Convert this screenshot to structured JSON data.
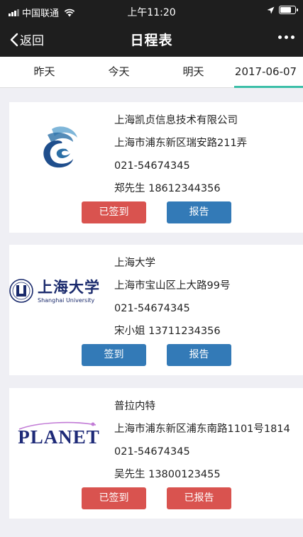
{
  "status_bar": {
    "carrier": "中国联通",
    "time": "上午11:20"
  },
  "nav": {
    "back_label": "返回",
    "title": "日程表"
  },
  "tabs": [
    {
      "label": "昨天",
      "active": false
    },
    {
      "label": "今天",
      "active": false
    },
    {
      "label": "明天",
      "active": false
    },
    {
      "label": "2017-06-07",
      "active": true
    }
  ],
  "accent_color": "#3cbfa8",
  "cards": [
    {
      "logo": "kaizhen-logo",
      "name": "上海凯贞信息技术有限公司",
      "address": "上海市浦东新区瑞安路211弄",
      "phone": "021-54674345",
      "contact": "郑先生 18612344356",
      "buttons": [
        {
          "label": "已签到",
          "color": "#d9534f"
        },
        {
          "label": "报告",
          "color": "#337ab7"
        }
      ]
    },
    {
      "logo": "shanghai-university-logo",
      "logo_text_cn": "上海大学",
      "logo_text_en": "Shanghai University",
      "name": "上海大学",
      "address": "上海市宝山区上大路99号",
      "phone": "021-54674345",
      "contact": "宋小姐 13711234356",
      "buttons": [
        {
          "label": "签到",
          "color": "#337ab7"
        },
        {
          "label": "报告",
          "color": "#337ab7"
        }
      ]
    },
    {
      "logo": "planet-logo",
      "logo_text": "PLANET",
      "name": "普拉内特",
      "address": "上海市浦东新区浦东南路1101号1814",
      "phone": "021-54674345",
      "contact": "吴先生 13800123455",
      "buttons": [
        {
          "label": "已签到",
          "color": "#d9534f"
        },
        {
          "label": "已报告",
          "color": "#d9534f"
        }
      ]
    }
  ]
}
